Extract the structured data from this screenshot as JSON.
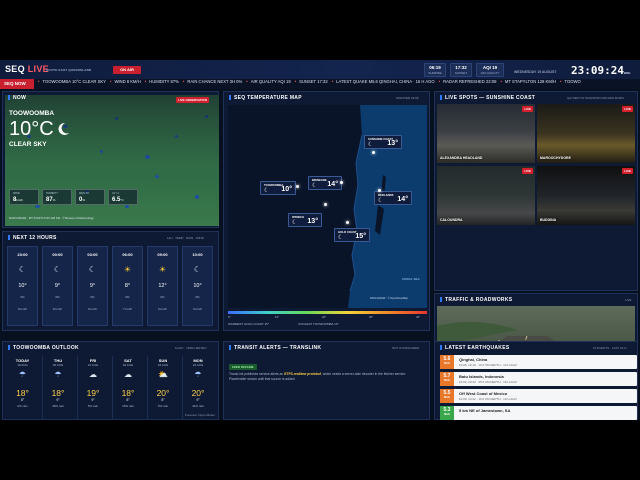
{
  "header": {
    "logo_main": "SEQ",
    "logo_accent": "LIVE",
    "subtitle": "SOUTH EAST QUEENSLAND",
    "on_air": "ON AIR",
    "sunrise": {
      "value": "06:19",
      "label": "SUNRISE"
    },
    "sunset": {
      "value": "17:32",
      "label": "SUNSET"
    },
    "aqi": {
      "value": "AQI 19",
      "label": "AIR QUALITY"
    },
    "clock": "23:09:24",
    "date": "WEDNESDAY 19 AUGUST",
    "tz": "BNE"
  },
  "ticker": {
    "tag": "SEQ NOW",
    "items": [
      {
        "label": "TOOWOOMBA 10°C CLEAR SKY"
      },
      {
        "label": "WIND 8 KM/H"
      },
      {
        "label": "HUMIDITY 87%"
      },
      {
        "label": "RAIN CHANCE NEXT 3H 0%"
      },
      {
        "label": "AIR QUALITY AQI 19"
      },
      {
        "label": "SUNSET 17:32"
      },
      {
        "label": "LATEST QUAKE M5.6 QINGHAI, CHINA · 16 H AGO"
      },
      {
        "label": "RADAR REFRESHED 23:08"
      },
      {
        "label": "MT STAPYLTON 128 KM/H"
      },
      {
        "label": "TOOWO"
      }
    ]
  },
  "now": {
    "title": "NOW",
    "badge": "LIVE OBSERVATION",
    "location": "TOOWOOMBA",
    "temp": "10°C",
    "condition": "CLEAR SKY",
    "stats": [
      {
        "label": "WIND",
        "value": "8",
        "unit": "km/h"
      },
      {
        "label": "HUMIDITY",
        "value": "87",
        "unit": "%"
      },
      {
        "label": "RAIN 3H",
        "value": "0",
        "unit": "%"
      },
      {
        "label": "UV / 3",
        "value": "6.5",
        "unit": "°C"
      }
    ],
    "caption": "RAIN RADAR · MT STAPYLTON 128 KM · © Bureau of Meteorology"
  },
  "next12": {
    "title": "NEXT 12 HOURS",
    "meta": "12H · TEMP · RAIN · WIND",
    "hours": [
      {
        "time": "23:00",
        "icon": "moon-icon",
        "temp": "10°",
        "rain": "0%",
        "wind": "8 km/h"
      },
      {
        "time": "00:00",
        "icon": "moon-icon",
        "temp": "9°",
        "rain": "0%",
        "wind": "8 km/h"
      },
      {
        "time": "03:00",
        "icon": "moon-icon",
        "temp": "9°",
        "rain": "0%",
        "wind": "6 km/h"
      },
      {
        "time": "06:00",
        "icon": "sun-icon",
        "temp": "8°",
        "rain": "0%",
        "wind": "7 km/h"
      },
      {
        "time": "09:00",
        "icon": "sun-icon",
        "temp": "12°",
        "rain": "0%",
        "wind": "9 km/h"
      },
      {
        "time": "10:00",
        "icon": "moon-icon",
        "temp": "10°",
        "rain": "0%",
        "wind": "9 km/h"
      }
    ]
  },
  "outlook": {
    "title": "TOOWOOMBA OUTLOOK",
    "meta": "5-DAY · OPEN-METEO",
    "days": [
      {
        "day": "TODAY",
        "date": "19 AUG",
        "icon": "rain-icon",
        "high": "18°",
        "low": "8°",
        "rain": "0% rain"
      },
      {
        "day": "THU",
        "date": "20 AUG",
        "icon": "rain-icon",
        "high": "18°",
        "low": "9°",
        "rain": "48% rain"
      },
      {
        "day": "FRI",
        "date": "21 AUG",
        "icon": "cloud-icon",
        "high": "19°",
        "low": "9°",
        "rain": "5% rain"
      },
      {
        "day": "SAT",
        "date": "22 AUG",
        "icon": "cloud-icon",
        "high": "18°",
        "low": "8°",
        "rain": "15% rain"
      },
      {
        "day": "SUN",
        "date": "23 AUG",
        "icon": "partly-sunny-icon",
        "high": "20°",
        "low": "8°",
        "rain": "5% rain"
      },
      {
        "day": "MON",
        "date": "24 AUG",
        "icon": "rain-icon",
        "high": "20°",
        "low": "9°",
        "rain": "44% rain"
      }
    ],
    "caption": "Forecast: Open-Meteo"
  },
  "tempmap": {
    "title": "SEQ TEMPERATURE MAP",
    "updated": "UPDATED 23:09",
    "cities": [
      {
        "name": "SUNSHINE COAST",
        "temp": "13°"
      },
      {
        "name": "BRISBANE",
        "temp": "14°"
      },
      {
        "name": "TOOWOOMBA",
        "temp": "10°"
      },
      {
        "name": "REDLANDS",
        "temp": "14°"
      },
      {
        "name": "IPSWICH",
        "temp": "13°"
      },
      {
        "name": "GOLD COAST",
        "temp": "15°"
      }
    ],
    "sea_label": "CORAL SEA",
    "source": "RAIN RADAR · © OpenStreetMap",
    "warmest": "WARMEST GOLD COAST 15°",
    "coolest": "COOLEST TOOWOOMBA 10°",
    "scale": [
      "0°",
      "10°",
      "20°",
      "30°",
      "40°"
    ],
    "scale_colors": [
      "#3b6cff",
      "#3fd1c9",
      "#6ad957",
      "#f2d33a",
      "#f08a2a",
      "#e8352f"
    ]
  },
  "livespots": {
    "title": "LIVE SPOTS — SUNSHINE COAST",
    "meta": "QLD DEPT OF TRANSPORT AND MAIN ROADS",
    "live": "LIVE",
    "cams": [
      {
        "label": "ALEXANDRA HEADLAND"
      },
      {
        "label": "MAROOCHYDORE"
      },
      {
        "label": "CALOUNDRA"
      },
      {
        "label": "BUDDINA"
      }
    ]
  },
  "traffic": {
    "title": "TRAFFIC & ROADWORKS",
    "live": "LIVE",
    "cam_label": "WARREGO HWY — BUNDAMBA"
  },
  "transit": {
    "title": "TRANSIT ALERTS — TRANSLINK",
    "meta": "NOT CONFIGURED",
    "badge": "FEED OFFLINE",
    "text_a": "TransLink publishes service alerts as ",
    "text_b": "GTFS-realtime protobuf",
    "text_c": ", which needs a server-side decoder in the fetcher service. Placeholder shown until that source is added."
  },
  "quakes": {
    "title": "LATEST EARTHQUAKES",
    "meta": "15 EVENTS · LAST 24 H",
    "events": [
      {
        "mag": "5.6",
        "place": "Qinghai, China",
        "detail": "10:05, 23:19 · 10.0 KM DEPTH · 16 H AGO",
        "color": "#e8772a"
      },
      {
        "mag": "5.7",
        "place": "Batu Islands, Indonesia",
        "detail": "10:02, 20:32 · 35.0 KM DEPTH · 18 H AGO",
        "color": "#e8772a"
      },
      {
        "mag": "5.5",
        "place": "Off West Coast of Mexico",
        "detail": "10:06, 14:22 · 10.0 KM DEPTH · 19 H AGO",
        "color": "#e8772a"
      },
      {
        "mag": "5.3",
        "place": "5 km NE of Jamestown, SA",
        "detail": "",
        "color": "#3aa84a"
      }
    ]
  }
}
